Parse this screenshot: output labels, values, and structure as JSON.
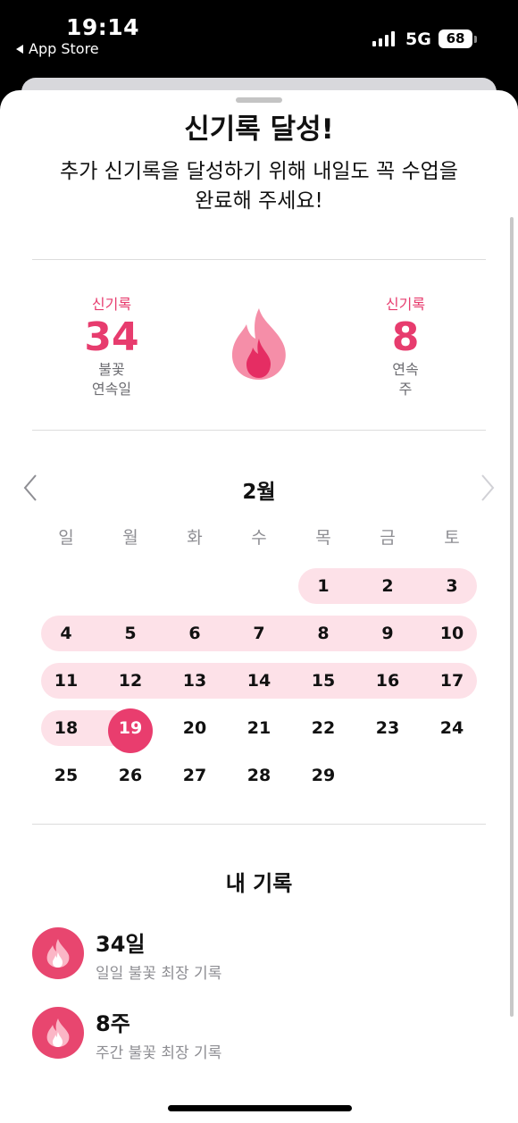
{
  "status": {
    "time": "19:14",
    "back_app": "App Store",
    "network": "5G",
    "battery": "68"
  },
  "header": {
    "title": "신기록 달성!",
    "subtitle": "추가 신기록을 달성하기 위해 내일도 꼭 수업을 완료해 주세요!"
  },
  "stats": {
    "left": {
      "label": "신기록",
      "value": "34",
      "desc_line1": "불꽃",
      "desc_line2": "연속일"
    },
    "right": {
      "label": "신기록",
      "value": "8",
      "desc_line1": "연속",
      "desc_line2": "주"
    }
  },
  "calendar": {
    "month": "2월",
    "weekdays": [
      "일",
      "월",
      "화",
      "수",
      "목",
      "금",
      "토"
    ],
    "today": "19",
    "days": {
      "d1": "1",
      "d2": "2",
      "d3": "3",
      "d4": "4",
      "d5": "5",
      "d6": "6",
      "d7": "7",
      "d8": "8",
      "d9": "9",
      "d10": "10",
      "d11": "11",
      "d12": "12",
      "d13": "13",
      "d14": "14",
      "d15": "15",
      "d16": "16",
      "d17": "17",
      "d18": "18",
      "d19": "19",
      "d20": "20",
      "d21": "21",
      "d22": "22",
      "d23": "23",
      "d24": "24",
      "d25": "25",
      "d26": "26",
      "d27": "27",
      "d28": "28",
      "d29": "29"
    }
  },
  "records": {
    "title": "내 기록",
    "items": [
      {
        "value": "34일",
        "desc": "일일 불꽃 최장 기록"
      },
      {
        "value": "8주",
        "desc": "주간 불꽃 최장 기록"
      }
    ]
  },
  "colors": {
    "accent": "#e93d6e",
    "streak_band": "#fde1e8",
    "flame_light": "#f58ea8"
  },
  "icons": {
    "flame": "flame-icon",
    "prev": "chevron-left-icon",
    "next": "chevron-right-icon"
  }
}
